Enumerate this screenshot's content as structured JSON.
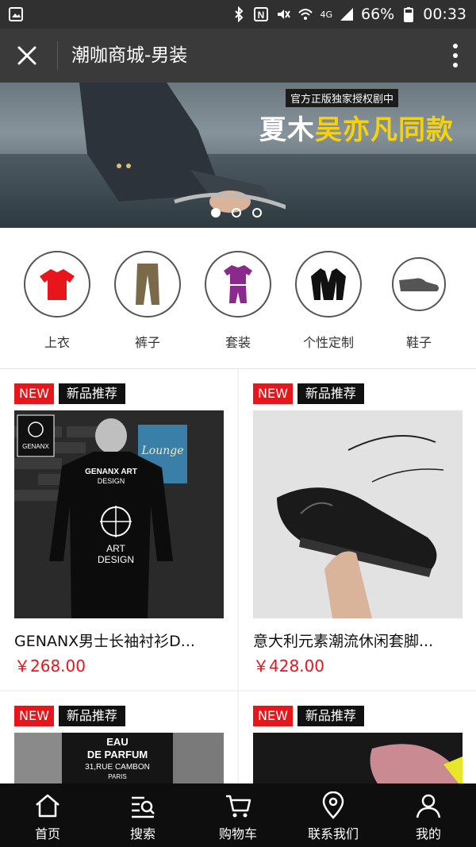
{
  "statusbar": {
    "battery": "66%",
    "time": "00:33",
    "network": "4G",
    "icons": [
      "image-icon",
      "bluetooth-icon",
      "nfc-icon",
      "mute-icon",
      "wifi-icon",
      "signal-icon",
      "battery-icon"
    ]
  },
  "header": {
    "title": "潮咖商城-男装",
    "close_icon": "close-icon",
    "more_icon": "more-vertical-icon"
  },
  "banner": {
    "caption_small": "官方正版独家授权剧中",
    "caption_big_prefix": "夏木",
    "caption_big_highlight": "吴亦凡同款",
    "slides_total": 3,
    "active_slide": 1
  },
  "categories": [
    {
      "label": "上衣",
      "icon": "tshirt-icon",
      "color": "#e8151b"
    },
    {
      "label": "裤子",
      "icon": "pants-icon",
      "color": "#7a6a4a"
    },
    {
      "label": "套装",
      "icon": "suit-set-icon",
      "color": "#8a2a8c"
    },
    {
      "label": "个性定制",
      "icon": "jacket-icon",
      "color": "#111111"
    },
    {
      "label": "鞋子",
      "icon": "shoe-icon",
      "color": "#555555"
    }
  ],
  "products": [
    {
      "tag_new": "NEW",
      "tag_rec": "新品推荐",
      "name": "GENANX男士长袖衬衫D...",
      "price": "￥268.00"
    },
    {
      "tag_new": "NEW",
      "tag_rec": "新品推荐",
      "name": "意大利元素潮流休闲套脚...",
      "price": "￥428.00"
    },
    {
      "tag_new": "NEW",
      "tag_rec": "新品推荐",
      "name": "",
      "price": ""
    },
    {
      "tag_new": "NEW",
      "tag_rec": "新品推荐",
      "name": "",
      "price": ""
    }
  ],
  "photo_text": {
    "genanx_logo": "GENANX",
    "genanx_art": "GENANX ART",
    "design": "DESIGN",
    "art": "ART",
    "lounge": "Lounge",
    "perfume_1": "EAU",
    "perfume_2": "DE PARFUM",
    "perfume_3": "31,RUE CAMBON",
    "perfume_4": "PARIS"
  },
  "bottomnav": [
    {
      "label": "首页",
      "icon": "home-icon"
    },
    {
      "label": "搜索",
      "icon": "search-list-icon"
    },
    {
      "label": "购物车",
      "icon": "cart-icon"
    },
    {
      "label": "联系我们",
      "icon": "location-pin-icon"
    },
    {
      "label": "我的",
      "icon": "user-icon"
    }
  ],
  "colors": {
    "accent_red": "#e8151b",
    "header_bg": "#3a3a3a",
    "statusbar_bg": "#303030",
    "nav_bg": "#0e0e0e",
    "highlight_yellow": "#f5d20c"
  }
}
